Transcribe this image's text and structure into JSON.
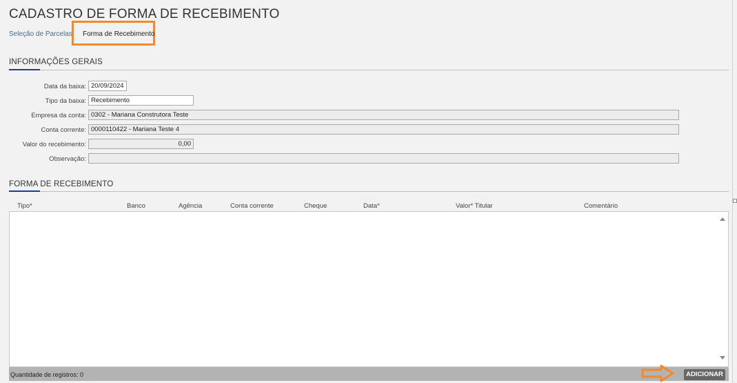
{
  "page": {
    "title": "CADASTRO DE FORMA DE RECEBIMENTO"
  },
  "tabs": [
    {
      "label": "Seleção de Parcelas",
      "active": false
    },
    {
      "label": "Forma de Recebimento",
      "active": true
    }
  ],
  "general": {
    "section_title": "INFORMAÇÕES GERAIS",
    "fields": [
      {
        "label": "Data da baixa:",
        "value": "20/09/2024"
      },
      {
        "label": "Tipo da baixa:",
        "value": "Recebimento"
      },
      {
        "label": "Empresa da conta:",
        "value": "0302 - Mariana Construtora Teste"
      },
      {
        "label": "Conta corrente:",
        "value": "0000110422 - Mariana Teste 4"
      },
      {
        "label": "Valor do recebimento:",
        "value": "0,00"
      },
      {
        "label": "Observação:",
        "value": ""
      }
    ]
  },
  "receipt_form": {
    "section_title": "FORMA DE RECEBIMENTO",
    "columns": [
      "Tipo*",
      "Banco",
      "Agência",
      "Conta corrente",
      "Cheque",
      "Data*",
      "Valor* Titular",
      "Comentário"
    ],
    "rows": [],
    "record_count_label": "Quantidade de registros: 0",
    "add_button_label": "ADICIONAR"
  },
  "colors": {
    "accent": "#203a8f",
    "highlight": "#f28a2b",
    "button": "#666666"
  }
}
